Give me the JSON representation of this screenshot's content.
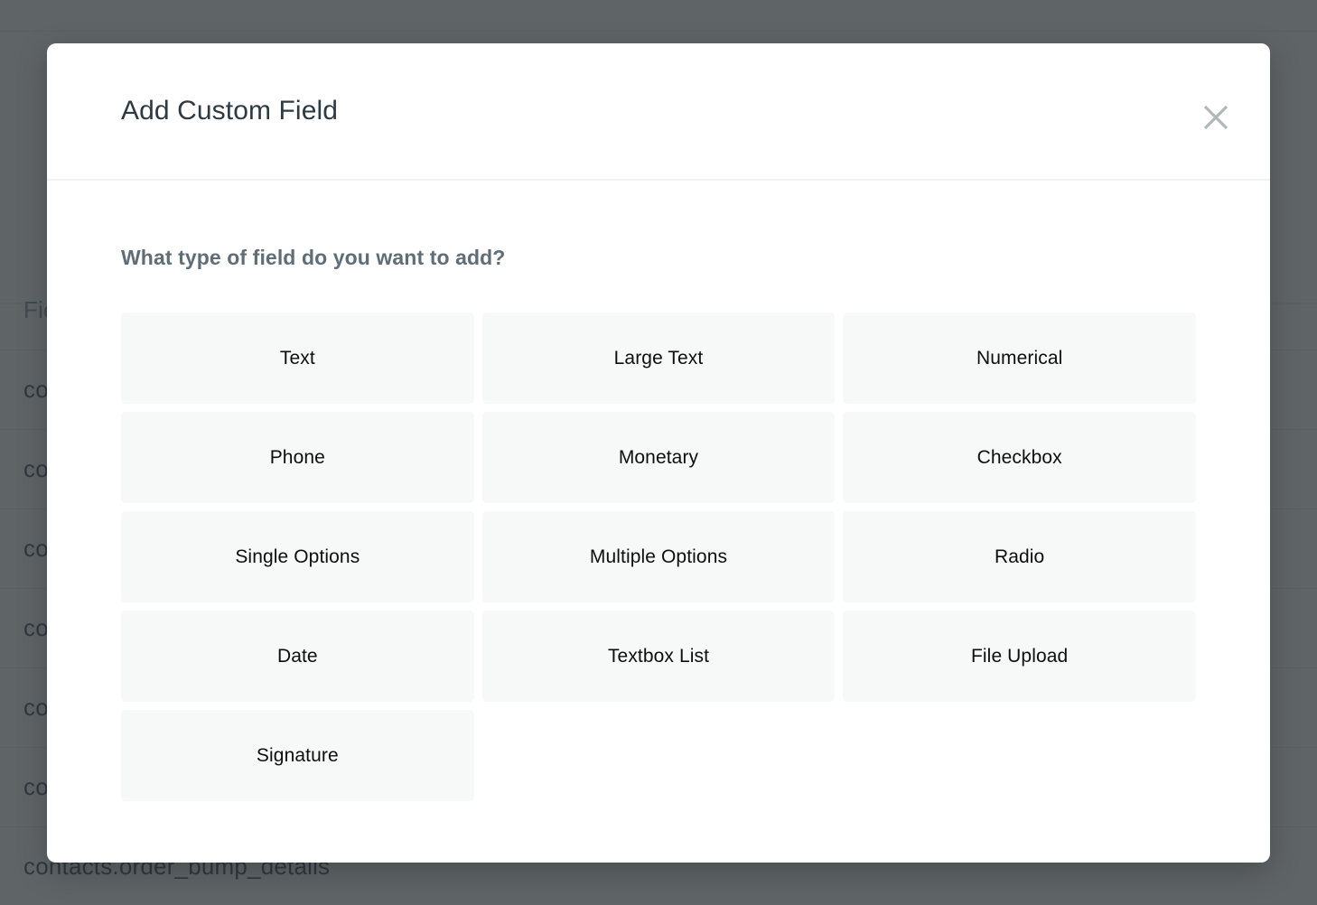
{
  "background": {
    "table": {
      "header_label": "Fie",
      "rows": [
        {
          "label": "co"
        },
        {
          "label": "co"
        },
        {
          "label": "co"
        },
        {
          "label": "co"
        },
        {
          "label": "co"
        },
        {
          "label": "co"
        },
        {
          "label": "contacts.order_bump_details"
        }
      ]
    }
  },
  "modal": {
    "title": "Add Custom Field",
    "close_icon": "close-icon",
    "question_label": "What type of field do you want to add?",
    "field_types": [
      {
        "label": "Text"
      },
      {
        "label": "Large Text"
      },
      {
        "label": "Numerical"
      },
      {
        "label": "Phone"
      },
      {
        "label": "Monetary"
      },
      {
        "label": "Checkbox"
      },
      {
        "label": "Single Options"
      },
      {
        "label": "Multiple Options"
      },
      {
        "label": "Radio"
      },
      {
        "label": "Date"
      },
      {
        "label": "Textbox List"
      },
      {
        "label": "File Upload"
      },
      {
        "label": "Signature"
      }
    ]
  },
  "colors": {
    "overlay": "#32383c",
    "modal_bg": "#ffffff",
    "title_text": "#2d3a43",
    "question_text": "#5f6d77",
    "button_bg": "#f7f8f8",
    "button_text": "#0e0e0e",
    "close_icon": "#b0b8bb",
    "divider": "#eef4f6"
  }
}
